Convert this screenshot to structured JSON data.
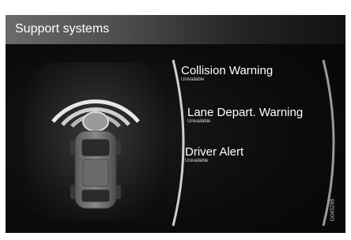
{
  "screen": {
    "header": {
      "title": "Support systems"
    },
    "items": [
      {
        "title": "Collision Warning",
        "status": "Univailable"
      },
      {
        "title": "Lane Depart. Warning",
        "status": "Univailable"
      },
      {
        "title": "Driver Alert",
        "status": "Univailable"
      }
    ],
    "image_code": "G045296",
    "illustration": {
      "icon": "car-top-view-with-radar-icon"
    },
    "colors": {
      "background": "#0c0c0c",
      "text": "#ffffff",
      "header_light": "#6a6a6a"
    }
  }
}
